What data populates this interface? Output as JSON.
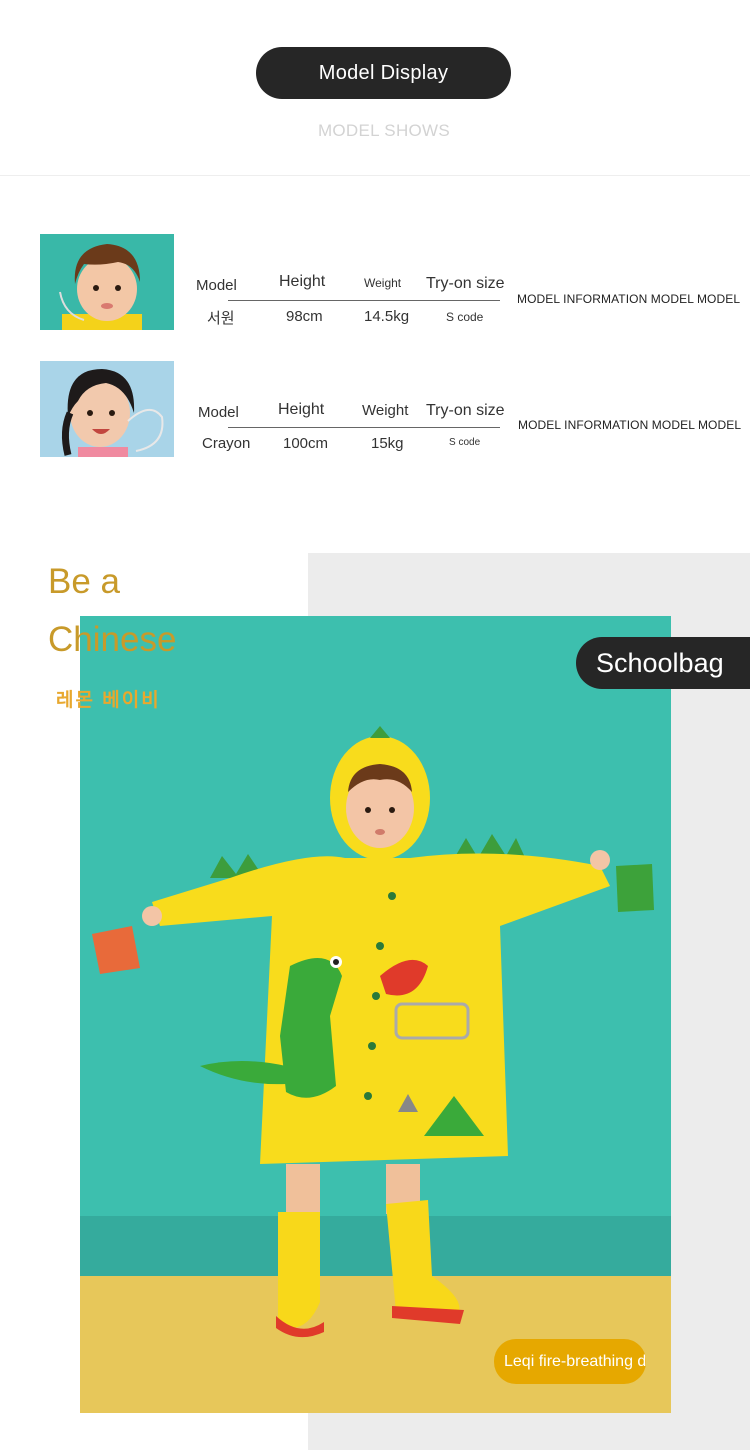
{
  "header": {
    "title": "Model Display",
    "subtitle": "MODEL SHOWS"
  },
  "models": [
    {
      "headers": [
        "Model",
        "Height",
        "Weight",
        "Try-on size"
      ],
      "name": "서원",
      "height": "98cm",
      "weight": "14.5kg",
      "size": "S code",
      "info": "MODEL INFORMATION MODEL MODEL"
    },
    {
      "headers": [
        "Model",
        "Height",
        "Weight",
        "Try-on size"
      ],
      "name": "Crayon",
      "height": "100cm",
      "weight": "15kg",
      "size": "S code",
      "info": "MODEL INFORMATION MODEL MODEL"
    }
  ],
  "promo": {
    "line1": "Be a",
    "line2": "Chinese",
    "korean": "레몬 베이비",
    "schoolbag": "Schoolbag",
    "caption": "Leqi fire-breathing drag"
  },
  "colors": {
    "dark_pill": "#262626",
    "gold_text": "#c89a2a",
    "caption_yellow": "#e6a800",
    "teal_background": "#3dbfae",
    "raincoat_yellow": "#f8dc1c"
  }
}
